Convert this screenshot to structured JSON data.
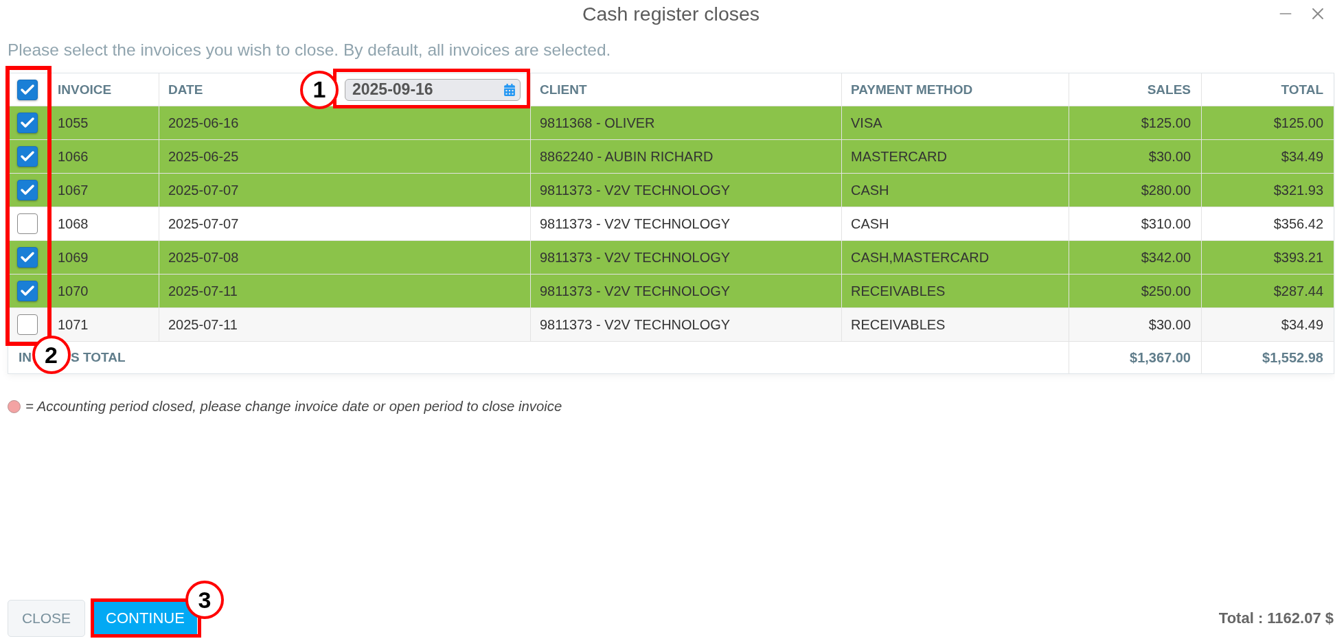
{
  "window": {
    "title": "Cash register closes"
  },
  "instruction": "Please select the invoices you wish to close. By default, all invoices are selected.",
  "table": {
    "select_all": {
      "checked": true
    },
    "selection_callout": {
      "number": "2"
    },
    "columns": [
      {
        "label": "INVOICE",
        "kind": "text"
      },
      {
        "label": "DATE",
        "kind": "text",
        "filter": {
          "value": "2025-09-16",
          "callout": {
            "number": "1"
          }
        }
      },
      {
        "label": "CLIENT",
        "kind": "text"
      },
      {
        "label": "PAYMENT METHOD",
        "kind": "text"
      },
      {
        "label": "SALES",
        "kind": "amount"
      },
      {
        "label": "TOTAL",
        "kind": "amount"
      }
    ],
    "rows": [
      {
        "selected": true,
        "cells": [
          "1055",
          "2025-06-16",
          "9811368 - OLIVER",
          "VISA",
          "$125.00",
          "$125.00"
        ]
      },
      {
        "selected": true,
        "cells": [
          "1066",
          "2025-06-25",
          "8862240 - AUBIN RICHARD",
          "MASTERCARD",
          "$30.00",
          "$34.49"
        ]
      },
      {
        "selected": true,
        "cells": [
          "1067",
          "2025-07-07",
          "9811373 - V2V TECHNOLOGY",
          "CASH",
          "$280.00",
          "$321.93"
        ]
      },
      {
        "selected": false,
        "cells": [
          "1068",
          "2025-07-07",
          "9811373 - V2V TECHNOLOGY",
          "CASH",
          "$310.00",
          "$356.42"
        ]
      },
      {
        "selected": true,
        "cells": [
          "1069",
          "2025-07-08",
          "9811373 - V2V TECHNOLOGY",
          "CASH,MASTERCARD",
          "$342.00",
          "$393.21"
        ]
      },
      {
        "selected": true,
        "cells": [
          "1070",
          "2025-07-11",
          "9811373 - V2V TECHNOLOGY",
          "RECEIVABLES",
          "$250.00",
          "$287.44"
        ]
      },
      {
        "selected": false,
        "cells": [
          "1071",
          "2025-07-11",
          "9811373 - V2V TECHNOLOGY",
          "RECEIVABLES",
          "$30.00",
          "$34.49"
        ]
      }
    ],
    "footer": {
      "label_parts": [
        "IN",
        "S TOTAL"
      ],
      "values": [
        "$1,367.00",
        "$1,552.98"
      ]
    }
  },
  "legend": {
    "text": "= Accounting period closed, please change invoice date or open period to close invoice"
  },
  "buttons": [
    {
      "kind": "secondary",
      "label": "CLOSE"
    },
    {
      "kind": "primary",
      "label": "CONTINUE",
      "callout": {
        "number": "3"
      }
    }
  ],
  "grand_total": "Total : 1162.07 $"
}
